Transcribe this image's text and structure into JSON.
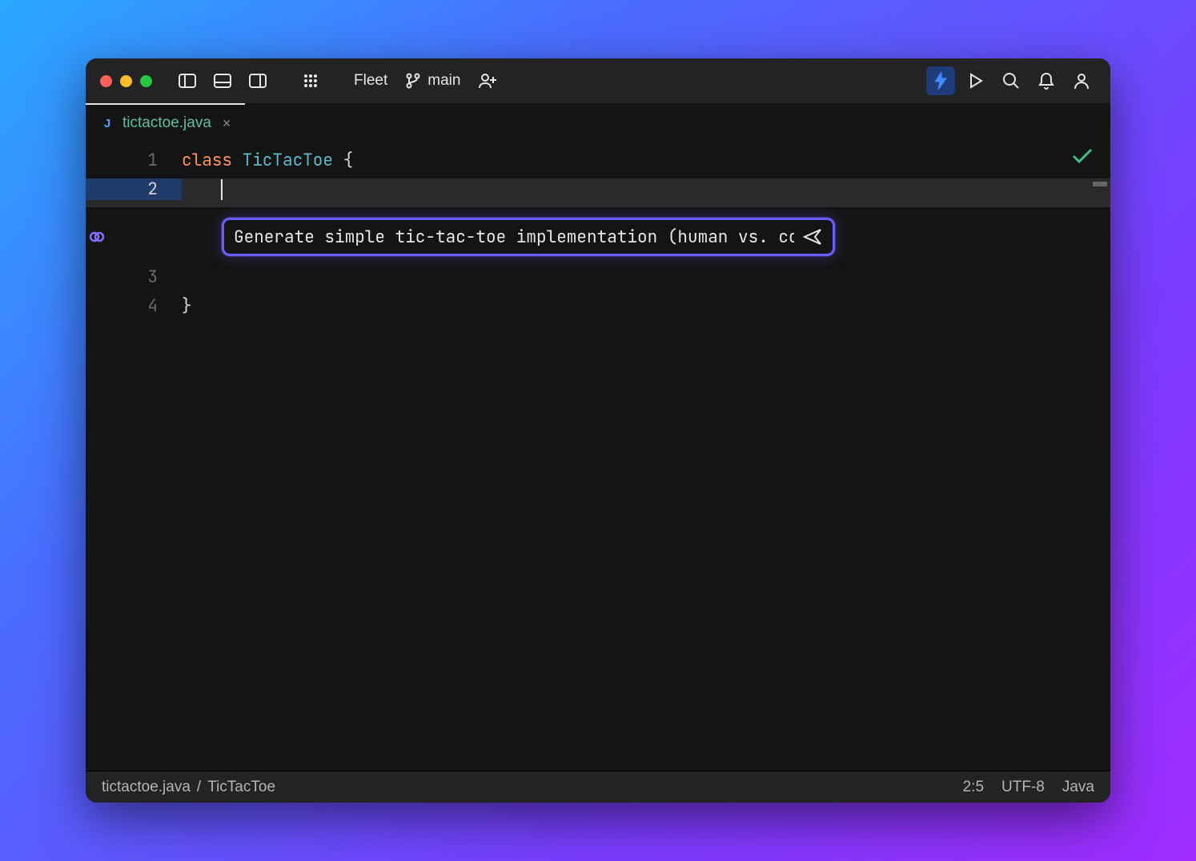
{
  "app": {
    "name": "Fleet"
  },
  "vcs": {
    "branch": "main"
  },
  "tab": {
    "filename": "tictactoe.java",
    "file_icon_letter": "J"
  },
  "editor": {
    "line1": {
      "num": "1",
      "kw": "class",
      "cls": "TicTacToe",
      "brace": " {"
    },
    "line2": {
      "num": "2"
    },
    "line3": {
      "num": "3"
    },
    "line4": {
      "num": "4",
      "brace": "}"
    }
  },
  "ai": {
    "prompt": "Generate simple tic-tac-toe implementation (human vs. computer)"
  },
  "status": {
    "path_file": "tictactoe.java",
    "path_sep": " / ",
    "path_symbol": "TicTacToe",
    "cursor": "2:5",
    "encoding": "UTF-8",
    "language": "Java"
  }
}
